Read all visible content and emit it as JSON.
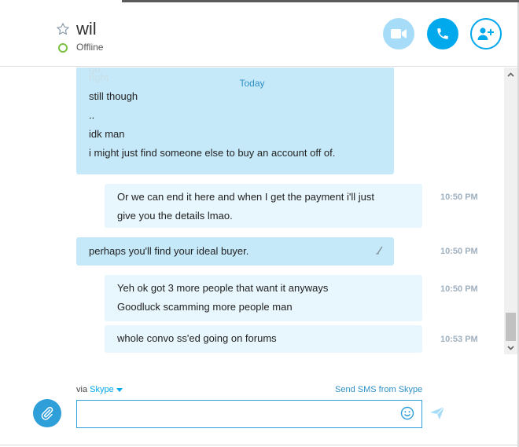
{
  "header": {
    "contact_name": "wil",
    "status": "Offline",
    "colors": {
      "accent": "#00a8ec",
      "online_ring": "#7ac143"
    }
  },
  "conversation": {
    "date_divider": "Today",
    "faded_lines": [
      "go",
      "right"
    ],
    "messages": [
      {
        "direction": "outgoing",
        "lines": [
          "still though",
          "..",
          "idk man",
          "i might just find someone else to buy an account off of."
        ],
        "time": ""
      },
      {
        "direction": "incoming",
        "lines": [
          "Or we can end it here and when I get the payment i'll just",
          "give you the details lmao."
        ],
        "time": "10:50 PM"
      },
      {
        "direction": "outgoing",
        "lines": [
          "perhaps you'll find your ideal buyer."
        ],
        "time": "10:50 PM"
      },
      {
        "direction": "incoming",
        "lines": [
          "Yeh ok got 3 more people that want it anyways",
          "Goodluck scamming more people man"
        ],
        "time": "10:50 PM"
      },
      {
        "direction": "incoming",
        "lines": [
          "whole convo ss'ed going on forums"
        ],
        "time": "10:53 PM"
      }
    ]
  },
  "composer": {
    "via_label": "via",
    "via_service": "Skype",
    "sms_link": "Send SMS from Skype",
    "input_value": "",
    "input_placeholder": ""
  },
  "icons": {
    "star": "star-icon",
    "video": "video-camera-icon",
    "call": "phone-icon",
    "add_contact": "add-person-icon",
    "attach": "paperclip-icon",
    "emoji": "smiley-icon",
    "send": "send-icon",
    "edit": "pencil-icon"
  }
}
